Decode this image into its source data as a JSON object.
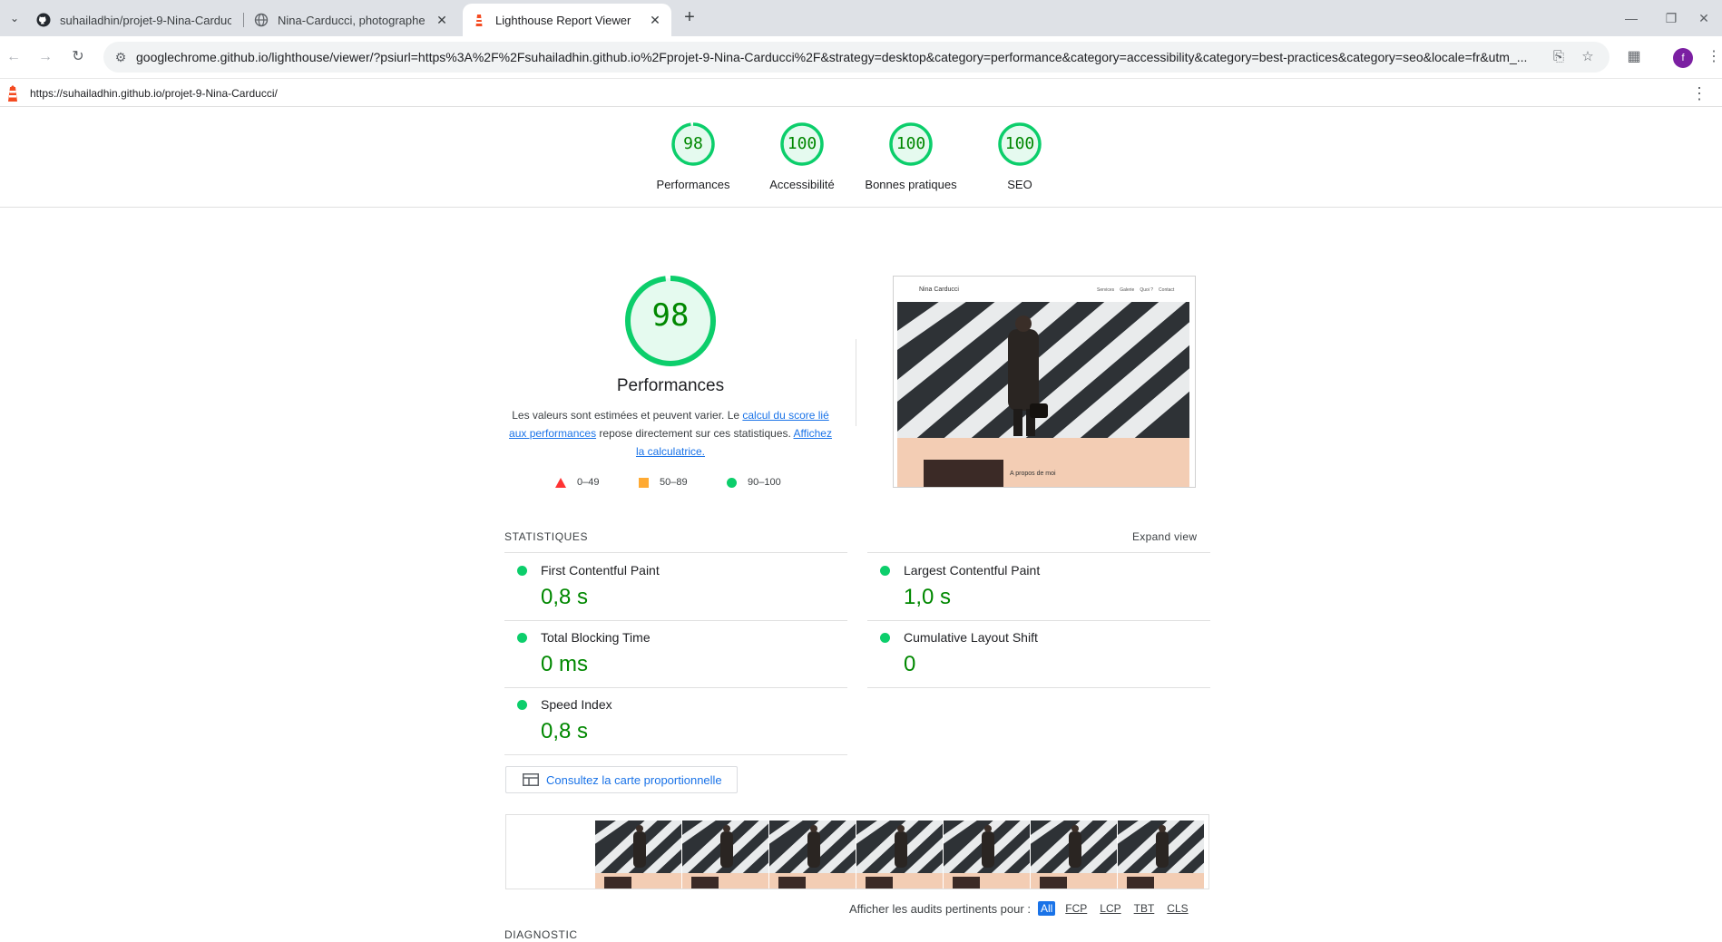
{
  "browser": {
    "tabs": [
      {
        "title": "suhailadhin/projet-9-Nina-Carducci",
        "icon": "github-icon"
      },
      {
        "title": "Nina-Carducci, photographe",
        "icon": "globe-icon"
      },
      {
        "title": "Lighthouse Report Viewer",
        "icon": "lighthouse-icon"
      }
    ],
    "address": "googlechrome.github.io/lighthouse/viewer/?psiurl=https%3A%2F%2Fsuhailadhin.github.io%2Fprojet-9-Nina-Carducci%2F&strategy=desktop&category=performance&category=accessibility&category=best-practices&category=seo&locale=fr&utm_...",
    "profile_initial": "f"
  },
  "report": {
    "url": "https://suhailadhin.github.io/projet-9-Nina-Carducci/",
    "categories": [
      {
        "label": "Performances",
        "score": "98"
      },
      {
        "label": "Accessibilité",
        "score": "100"
      },
      {
        "label": "Bonnes pratiques",
        "score": "100"
      },
      {
        "label": "SEO",
        "score": "100"
      }
    ],
    "perf": {
      "score": "98",
      "title": "Performances",
      "desc_a": "Les valeurs sont estimées et peuvent varier. Le ",
      "desc_link1": "calcul du score lié aux performances",
      "desc_b": " repose directement sur ces statistiques. ",
      "desc_link2": "Affichez la calculatrice.",
      "legend": [
        {
          "range": "0–49",
          "color": "#ff3333"
        },
        {
          "range": "50–89",
          "color": "#ffaa33"
        },
        {
          "range": "90–100",
          "color": "#0cce6b"
        }
      ]
    },
    "screenshot": {
      "brand": "Nina Carducci",
      "nav": [
        "Services",
        "Galerie",
        "Quoi ?",
        "Contact"
      ],
      "about": "A propos de moi"
    },
    "stats_title": "STATISTIQUES",
    "expand_label": "Expand view",
    "metrics": [
      {
        "name": "First Contentful Paint",
        "value": "0,8 s"
      },
      {
        "name": "Largest Contentful Paint",
        "value": "1,0 s"
      },
      {
        "name": "Total Blocking Time",
        "value": "0 ms"
      },
      {
        "name": "Cumulative Layout Shift",
        "value": "0"
      },
      {
        "name": "Speed Index",
        "value": "0,8 s"
      }
    ],
    "treemap_label": "Consultez la carte proportionnelle",
    "filter_label": "Afficher les audits pertinents pour :",
    "filter_chips": [
      "All",
      "FCP",
      "LCP",
      "TBT",
      "CLS"
    ],
    "diagnostic_title": "DIAGNOSTIC"
  },
  "colors": {
    "pass": "#0cce6b",
    "pass_text": "#008800",
    "link": "#1a73e8"
  }
}
